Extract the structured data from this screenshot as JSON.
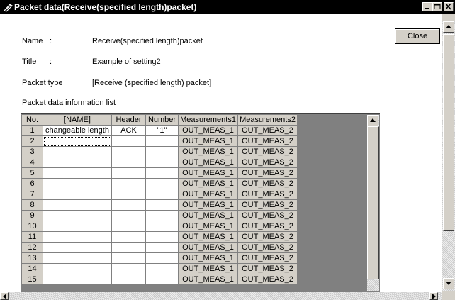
{
  "window": {
    "title": "Packet data(Receive(specified length)packet)"
  },
  "fields": {
    "name_label": "Name",
    "name_colon": ":",
    "name_value": "Receive(specified length)packet",
    "title_label": "Title",
    "title_colon": ":",
    "title_value": "Example of setting2",
    "packet_type_label": "Packet type",
    "packet_type_value": "[Receive (specified length) packet]",
    "list_label": "Packet data information list"
  },
  "buttons": {
    "close": "Close"
  },
  "table": {
    "headers": [
      "No.",
      "[NAME]",
      "Header",
      "Number",
      "Measurements1",
      "Measurements2"
    ],
    "rows": [
      [
        "1",
        "changeable length",
        "ACK",
        "\"1\"",
        "OUT_MEAS_1",
        "OUT_MEAS_2"
      ],
      [
        "2",
        "",
        "",
        "",
        "OUT_MEAS_1",
        "OUT_MEAS_2"
      ],
      [
        "3",
        "",
        "",
        "",
        "OUT_MEAS_1",
        "OUT_MEAS_2"
      ],
      [
        "4",
        "",
        "",
        "",
        "OUT_MEAS_1",
        "OUT_MEAS_2"
      ],
      [
        "5",
        "",
        "",
        "",
        "OUT_MEAS_1",
        "OUT_MEAS_2"
      ],
      [
        "6",
        "",
        "",
        "",
        "OUT_MEAS_1",
        "OUT_MEAS_2"
      ],
      [
        "7",
        "",
        "",
        "",
        "OUT_MEAS_1",
        "OUT_MEAS_2"
      ],
      [
        "8",
        "",
        "",
        "",
        "OUT_MEAS_1",
        "OUT_MEAS_2"
      ],
      [
        "9",
        "",
        "",
        "",
        "OUT_MEAS_1",
        "OUT_MEAS_2"
      ],
      [
        "10",
        "",
        "",
        "",
        "OUT_MEAS_1",
        "OUT_MEAS_2"
      ],
      [
        "11",
        "",
        "",
        "",
        "OUT_MEAS_1",
        "OUT_MEAS_2"
      ],
      [
        "12",
        "",
        "",
        "",
        "OUT_MEAS_1",
        "OUT_MEAS_2"
      ],
      [
        "13",
        "",
        "",
        "",
        "OUT_MEAS_1",
        "OUT_MEAS_2"
      ],
      [
        "14",
        "",
        "",
        "",
        "OUT_MEAS_1",
        "OUT_MEAS_2"
      ],
      [
        "15",
        "",
        "",
        "",
        "OUT_MEAS_1",
        "OUT_MEAS_2"
      ]
    ]
  },
  "icons": {
    "title": "packet-icon",
    "minimize": "minimize-icon",
    "maximize": "maximize-icon",
    "close": "close-icon"
  },
  "colors": {
    "face": "#d4d0c8",
    "titlebar": "#000000",
    "grid_empty": "#808080"
  }
}
